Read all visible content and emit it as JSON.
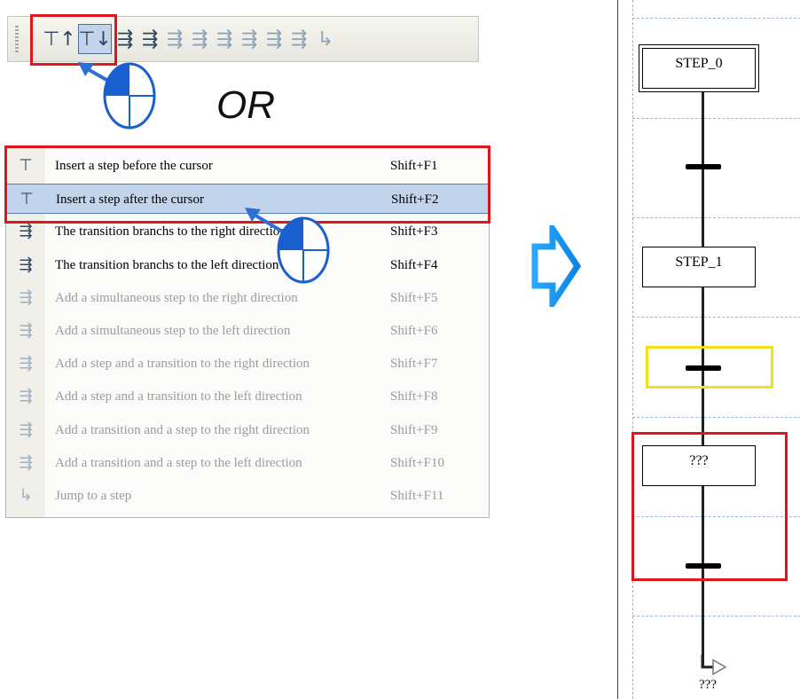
{
  "toolbar": {
    "buttons": [
      {
        "icon": "insert-step-before-icon",
        "glyph": "⊤↑"
      },
      {
        "icon": "insert-step-after-icon",
        "glyph": "⊤↓"
      },
      {
        "icon": "transition-branch-right-icon",
        "glyph": "⇶"
      },
      {
        "icon": "transition-branch-left-icon",
        "glyph": "⇶"
      },
      {
        "icon": "simultaneous-step-right-icon",
        "glyph": "⇶"
      },
      {
        "icon": "simultaneous-step-left-icon",
        "glyph": "⇶"
      },
      {
        "icon": "step-transition-right-icon",
        "glyph": "⇶"
      },
      {
        "icon": "step-transition-left-icon",
        "glyph": "⇶"
      },
      {
        "icon": "transition-step-right-icon",
        "glyph": "⇶"
      },
      {
        "icon": "transition-step-left-icon",
        "glyph": "⇶"
      },
      {
        "icon": "jump-to-step-icon",
        "glyph": "↳"
      }
    ]
  },
  "or_label": "OR",
  "menu": {
    "items": [
      {
        "label": "Insert a step before the cursor",
        "shortcut": "Shift+F1",
        "icon": "insert-step-before-icon",
        "enabled": true
      },
      {
        "label": "Insert a step after the cursor",
        "shortcut": "Shift+F2",
        "icon": "insert-step-after-icon",
        "enabled": true
      },
      {
        "label": "The transition branchs to the right direction",
        "shortcut": "Shift+F3",
        "icon": "transition-branch-right-icon",
        "enabled": true
      },
      {
        "label": "The transition branchs to the left direction",
        "shortcut": "Shift+F4",
        "icon": "transition-branch-left-icon",
        "enabled": true
      },
      {
        "label": "Add a simultaneous step to the right direction",
        "shortcut": "Shift+F5",
        "icon": "simultaneous-step-right-icon",
        "enabled": false
      },
      {
        "label": "Add a simultaneous step to the left direction",
        "shortcut": "Shift+F6",
        "icon": "simultaneous-step-left-icon",
        "enabled": false
      },
      {
        "label": "Add a step and a transition to the right direction",
        "shortcut": "Shift+F7",
        "icon": "step-transition-right-icon",
        "enabled": false
      },
      {
        "label": "Add a step and a transition to the left direction",
        "shortcut": "Shift+F8",
        "icon": "step-transition-left-icon",
        "enabled": false
      },
      {
        "label": "Add a transition and a step to the right direction",
        "shortcut": "Shift+F9",
        "icon": "transition-step-right-icon",
        "enabled": false
      },
      {
        "label": "Add a transition and a step to the left direction",
        "shortcut": "Shift+F10",
        "icon": "transition-step-left-icon",
        "enabled": false
      },
      {
        "label": "Jump to a step",
        "shortcut": "Shift+F11",
        "icon": "jump-to-step-icon",
        "enabled": false
      }
    ]
  },
  "sfc": {
    "step0": "STEP_0",
    "step1": "STEP_1",
    "new_step": "???",
    "jump_target": "???"
  },
  "colors": {
    "highlight_red": "#e0161f",
    "highlight_yellow": "#f2e21a",
    "arrow_blue": "#1a9cf0"
  }
}
